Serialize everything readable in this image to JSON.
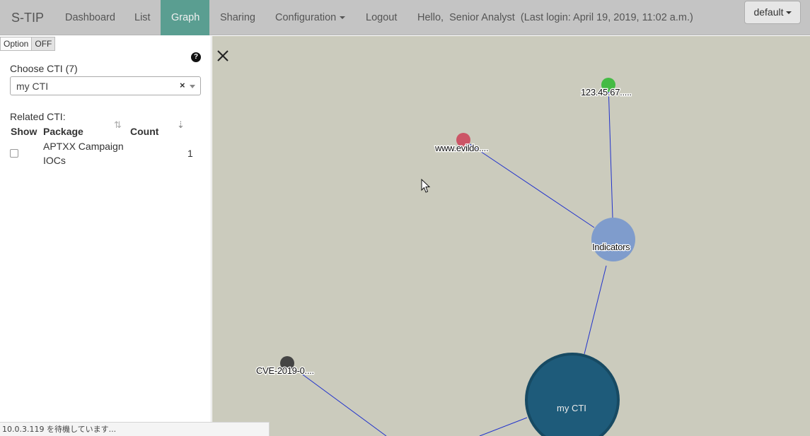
{
  "navbar": {
    "brand": "S-TIP",
    "items": [
      {
        "label": "Dashboard"
      },
      {
        "label": "List"
      },
      {
        "label": "Graph",
        "active": true
      },
      {
        "label": "Sharing"
      },
      {
        "label": "Configuration",
        "dropdown": true
      },
      {
        "label": "Logout"
      }
    ],
    "greeting": "Hello,  Senior Analyst  (Last login: April 19, 2019, 11:02 a.m.)",
    "profile_button": "default",
    "active_color": "#5a9e91"
  },
  "sidebar": {
    "option_label": "Option",
    "option_state": "OFF",
    "help_icon": "question-circle-icon",
    "choose_label": "Choose CTI (7)",
    "selected_cti": "my CTI",
    "clear_symbol": "×",
    "related_label": "Related CTI:",
    "columns": {
      "show": "Show",
      "package": "Package",
      "count": "Count"
    },
    "rows": [
      {
        "show": false,
        "package": "APTXX Campaign IOCs",
        "count": "1"
      }
    ]
  },
  "graph": {
    "background": "#cbcbbd",
    "edge_color": "#2233cc",
    "nodes": [
      {
        "id": "indicators",
        "label": "Indicators",
        "color": "#7f9ccc"
      },
      {
        "id": "evil",
        "label": "www.evildo....",
        "color": "#cc5566"
      },
      {
        "id": "ip",
        "label": "123.45.67.....",
        "color": "#44bb44"
      },
      {
        "id": "mycti",
        "label": "my CTI",
        "color": "#1e5b7a",
        "stroke": "#174a63"
      },
      {
        "id": "cve",
        "label": "CVE-2019-0....",
        "color": "#444444"
      }
    ]
  },
  "statusbar": {
    "text": "10.0.3.119 を待機しています..."
  }
}
